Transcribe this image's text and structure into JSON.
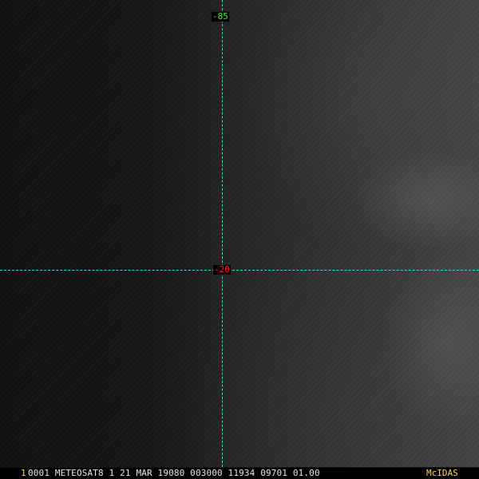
{
  "frame": {
    "number": "1"
  },
  "status": {
    "text": "0001 METEOSAT8    1 21 MAR 19080 003000 11934 09701 01.00",
    "brand": "McIDAS"
  },
  "grid": {
    "longitude_label": "-85",
    "latitude_label": "-20",
    "line_color": "#3fd6d6",
    "longitude_label_color": "#3cf03c",
    "latitude_label_color": "#ff2a2a"
  },
  "colors": {
    "frame_number": "#ffd24a",
    "brand": "#ffd24a",
    "status_text": "#e6e6e6"
  }
}
